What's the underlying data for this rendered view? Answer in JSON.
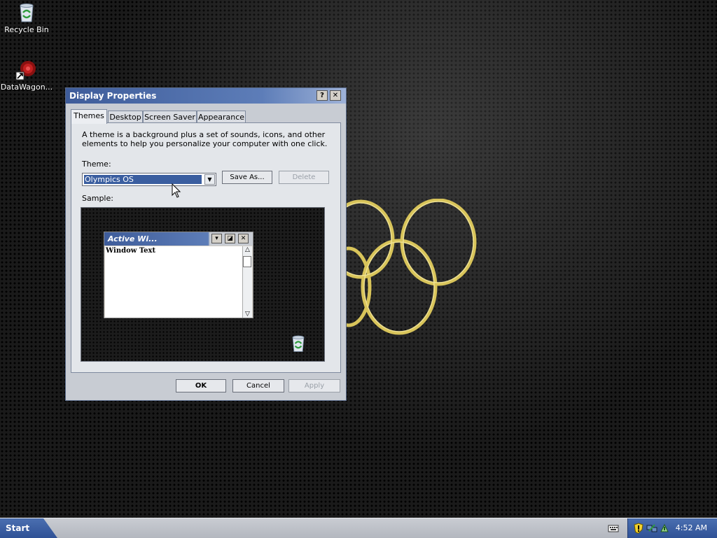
{
  "desktop": {
    "icons": [
      {
        "label": "Recycle Bin",
        "icon": "recycle-bin-icon"
      },
      {
        "label": "DataWagon...",
        "icon": "datawagon-icon"
      }
    ]
  },
  "dialog": {
    "title": "Display Properties",
    "title_buttons": {
      "help": "?",
      "close": "✕"
    },
    "tabs": [
      {
        "label": "Themes",
        "active": true
      },
      {
        "label": "Desktop",
        "active": false
      },
      {
        "label": "Screen Saver",
        "active": false
      },
      {
        "label": "Appearance",
        "active": false
      }
    ],
    "description": "A theme is a background plus a set of sounds, icons, and other elements to help you personalize your computer with one click.",
    "theme_label": "Theme:",
    "theme_value": "Olympics OS",
    "save_as_label": "Save As...",
    "delete_label": "Delete",
    "sample_label": "Sample:",
    "sample": {
      "window_title": "Active Wi...",
      "window_text": "Window Text"
    },
    "ok_label": "OK",
    "cancel_label": "Cancel",
    "apply_label": "Apply"
  },
  "taskbar": {
    "start_label": "Start",
    "clock": "4:52 AM"
  },
  "colors": {
    "title_gradient_start": "#3e5c9a",
    "taskbar_blue": "#2f5196",
    "ring_gold": "#d8c45a"
  }
}
